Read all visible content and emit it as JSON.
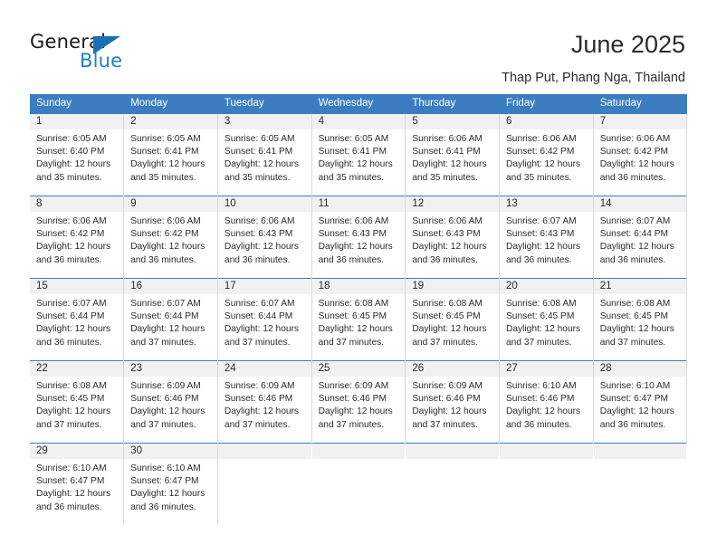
{
  "logo": {
    "word1": "General",
    "word2": "Blue",
    "triangle_color": "#1a6fb5",
    "blue_color": "#1f7fc4"
  },
  "header": {
    "title": "June 2025",
    "location": "Thap Put, Phang Nga, Thailand",
    "header_bg": "#3b7dc0"
  },
  "calendar": {
    "weekday_headers": [
      "Sunday",
      "Monday",
      "Tuesday",
      "Wednesday",
      "Thursday",
      "Friday",
      "Saturday"
    ],
    "labels": {
      "sunrise": "Sunrise:",
      "sunset": "Sunset:",
      "daylight": "Daylight:"
    },
    "weeks": [
      [
        {
          "day": "1",
          "sunrise": "Sunrise: 6:05 AM",
          "sunset": "Sunset: 6:40 PM",
          "daylight_line1": "Daylight: 12 hours",
          "daylight_line2": "and 35 minutes."
        },
        {
          "day": "2",
          "sunrise": "Sunrise: 6:05 AM",
          "sunset": "Sunset: 6:41 PM",
          "daylight_line1": "Daylight: 12 hours",
          "daylight_line2": "and 35 minutes."
        },
        {
          "day": "3",
          "sunrise": "Sunrise: 6:05 AM",
          "sunset": "Sunset: 6:41 PM",
          "daylight_line1": "Daylight: 12 hours",
          "daylight_line2": "and 35 minutes."
        },
        {
          "day": "4",
          "sunrise": "Sunrise: 6:05 AM",
          "sunset": "Sunset: 6:41 PM",
          "daylight_line1": "Daylight: 12 hours",
          "daylight_line2": "and 35 minutes."
        },
        {
          "day": "5",
          "sunrise": "Sunrise: 6:06 AM",
          "sunset": "Sunset: 6:41 PM",
          "daylight_line1": "Daylight: 12 hours",
          "daylight_line2": "and 35 minutes."
        },
        {
          "day": "6",
          "sunrise": "Sunrise: 6:06 AM",
          "sunset": "Sunset: 6:42 PM",
          "daylight_line1": "Daylight: 12 hours",
          "daylight_line2": "and 35 minutes."
        },
        {
          "day": "7",
          "sunrise": "Sunrise: 6:06 AM",
          "sunset": "Sunset: 6:42 PM",
          "daylight_line1": "Daylight: 12 hours",
          "daylight_line2": "and 36 minutes."
        }
      ],
      [
        {
          "day": "8",
          "sunrise": "Sunrise: 6:06 AM",
          "sunset": "Sunset: 6:42 PM",
          "daylight_line1": "Daylight: 12 hours",
          "daylight_line2": "and 36 minutes."
        },
        {
          "day": "9",
          "sunrise": "Sunrise: 6:06 AM",
          "sunset": "Sunset: 6:42 PM",
          "daylight_line1": "Daylight: 12 hours",
          "daylight_line2": "and 36 minutes."
        },
        {
          "day": "10",
          "sunrise": "Sunrise: 6:06 AM",
          "sunset": "Sunset: 6:43 PM",
          "daylight_line1": "Daylight: 12 hours",
          "daylight_line2": "and 36 minutes."
        },
        {
          "day": "11",
          "sunrise": "Sunrise: 6:06 AM",
          "sunset": "Sunset: 6:43 PM",
          "daylight_line1": "Daylight: 12 hours",
          "daylight_line2": "and 36 minutes."
        },
        {
          "day": "12",
          "sunrise": "Sunrise: 6:06 AM",
          "sunset": "Sunset: 6:43 PM",
          "daylight_line1": "Daylight: 12 hours",
          "daylight_line2": "and 36 minutes."
        },
        {
          "day": "13",
          "sunrise": "Sunrise: 6:07 AM",
          "sunset": "Sunset: 6:43 PM",
          "daylight_line1": "Daylight: 12 hours",
          "daylight_line2": "and 36 minutes."
        },
        {
          "day": "14",
          "sunrise": "Sunrise: 6:07 AM",
          "sunset": "Sunset: 6:44 PM",
          "daylight_line1": "Daylight: 12 hours",
          "daylight_line2": "and 36 minutes."
        }
      ],
      [
        {
          "day": "15",
          "sunrise": "Sunrise: 6:07 AM",
          "sunset": "Sunset: 6:44 PM",
          "daylight_line1": "Daylight: 12 hours",
          "daylight_line2": "and 36 minutes."
        },
        {
          "day": "16",
          "sunrise": "Sunrise: 6:07 AM",
          "sunset": "Sunset: 6:44 PM",
          "daylight_line1": "Daylight: 12 hours",
          "daylight_line2": "and 37 minutes."
        },
        {
          "day": "17",
          "sunrise": "Sunrise: 6:07 AM",
          "sunset": "Sunset: 6:44 PM",
          "daylight_line1": "Daylight: 12 hours",
          "daylight_line2": "and 37 minutes."
        },
        {
          "day": "18",
          "sunrise": "Sunrise: 6:08 AM",
          "sunset": "Sunset: 6:45 PM",
          "daylight_line1": "Daylight: 12 hours",
          "daylight_line2": "and 37 minutes."
        },
        {
          "day": "19",
          "sunrise": "Sunrise: 6:08 AM",
          "sunset": "Sunset: 6:45 PM",
          "daylight_line1": "Daylight: 12 hours",
          "daylight_line2": "and 37 minutes."
        },
        {
          "day": "20",
          "sunrise": "Sunrise: 6:08 AM",
          "sunset": "Sunset: 6:45 PM",
          "daylight_line1": "Daylight: 12 hours",
          "daylight_line2": "and 37 minutes."
        },
        {
          "day": "21",
          "sunrise": "Sunrise: 6:08 AM",
          "sunset": "Sunset: 6:45 PM",
          "daylight_line1": "Daylight: 12 hours",
          "daylight_line2": "and 37 minutes."
        }
      ],
      [
        {
          "day": "22",
          "sunrise": "Sunrise: 6:08 AM",
          "sunset": "Sunset: 6:45 PM",
          "daylight_line1": "Daylight: 12 hours",
          "daylight_line2": "and 37 minutes."
        },
        {
          "day": "23",
          "sunrise": "Sunrise: 6:09 AM",
          "sunset": "Sunset: 6:46 PM",
          "daylight_line1": "Daylight: 12 hours",
          "daylight_line2": "and 37 minutes."
        },
        {
          "day": "24",
          "sunrise": "Sunrise: 6:09 AM",
          "sunset": "Sunset: 6:46 PM",
          "daylight_line1": "Daylight: 12 hours",
          "daylight_line2": "and 37 minutes."
        },
        {
          "day": "25",
          "sunrise": "Sunrise: 6:09 AM",
          "sunset": "Sunset: 6:46 PM",
          "daylight_line1": "Daylight: 12 hours",
          "daylight_line2": "and 37 minutes."
        },
        {
          "day": "26",
          "sunrise": "Sunrise: 6:09 AM",
          "sunset": "Sunset: 6:46 PM",
          "daylight_line1": "Daylight: 12 hours",
          "daylight_line2": "and 37 minutes."
        },
        {
          "day": "27",
          "sunrise": "Sunrise: 6:10 AM",
          "sunset": "Sunset: 6:46 PM",
          "daylight_line1": "Daylight: 12 hours",
          "daylight_line2": "and 36 minutes."
        },
        {
          "day": "28",
          "sunrise": "Sunrise: 6:10 AM",
          "sunset": "Sunset: 6:47 PM",
          "daylight_line1": "Daylight: 12 hours",
          "daylight_line2": "and 36 minutes."
        }
      ],
      [
        {
          "day": "29",
          "sunrise": "Sunrise: 6:10 AM",
          "sunset": "Sunset: 6:47 PM",
          "daylight_line1": "Daylight: 12 hours",
          "daylight_line2": "and 36 minutes."
        },
        {
          "day": "30",
          "sunrise": "Sunrise: 6:10 AM",
          "sunset": "Sunset: 6:47 PM",
          "daylight_line1": "Daylight: 12 hours",
          "daylight_line2": "and 36 minutes."
        },
        {
          "day": "",
          "sunrise": "",
          "sunset": "",
          "daylight_line1": "",
          "daylight_line2": ""
        },
        {
          "day": "",
          "sunrise": "",
          "sunset": "",
          "daylight_line1": "",
          "daylight_line2": ""
        },
        {
          "day": "",
          "sunrise": "",
          "sunset": "",
          "daylight_line1": "",
          "daylight_line2": ""
        },
        {
          "day": "",
          "sunrise": "",
          "sunset": "",
          "daylight_line1": "",
          "daylight_line2": ""
        },
        {
          "day": "",
          "sunrise": "",
          "sunset": "",
          "daylight_line1": "",
          "daylight_line2": ""
        }
      ]
    ]
  }
}
